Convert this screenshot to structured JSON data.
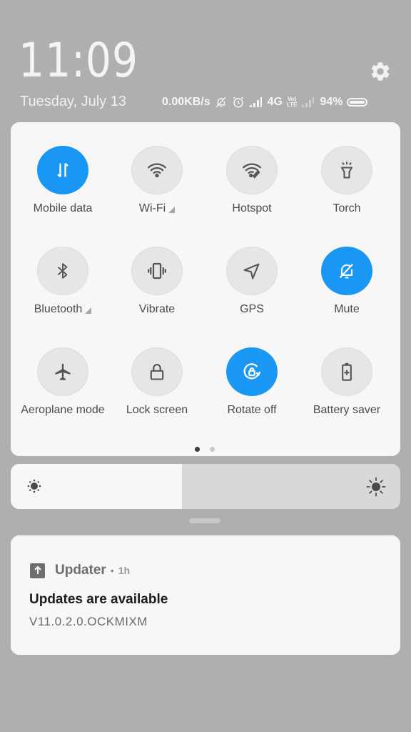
{
  "header": {
    "time": "11:09",
    "date": "Tuesday, July 13",
    "settings_icon": "gear-icon"
  },
  "status_bar": {
    "network_speed": "0.00KB/s",
    "icons": [
      "bell-off-icon",
      "alarm-icon",
      "signal-icon",
      "signal-icon-dim",
      "battery-icon"
    ],
    "network_type": "4G",
    "volte_top": "Vo)",
    "volte_bottom": "LTE",
    "battery_percent": "94%"
  },
  "quick_settings": {
    "tiles": [
      {
        "label": "Mobile data",
        "icon": "mobile-data-icon",
        "active": true,
        "has_expand": false
      },
      {
        "label": "Wi-Fi",
        "icon": "wifi-icon",
        "active": false,
        "has_expand": true
      },
      {
        "label": "Hotspot",
        "icon": "hotspot-icon",
        "active": false,
        "has_expand": false
      },
      {
        "label": "Torch",
        "icon": "torch-icon",
        "active": false,
        "has_expand": false
      },
      {
        "label": "Bluetooth",
        "icon": "bluetooth-icon",
        "active": false,
        "has_expand": true
      },
      {
        "label": "Vibrate",
        "icon": "vibrate-icon",
        "active": false,
        "has_expand": false
      },
      {
        "label": "GPS",
        "icon": "gps-icon",
        "active": false,
        "has_expand": false
      },
      {
        "label": "Mute",
        "icon": "bell-off-icon",
        "active": true,
        "has_expand": false
      },
      {
        "label": "Aeroplane mode",
        "icon": "airplane-icon",
        "active": false,
        "has_expand": false
      },
      {
        "label": "Lock screen",
        "icon": "lock-icon",
        "active": false,
        "has_expand": false
      },
      {
        "label": "Rotate off",
        "icon": "rotate-lock-icon",
        "active": true,
        "has_expand": false
      },
      {
        "label": "Battery saver",
        "icon": "battery-saver-icon",
        "active": false,
        "has_expand": false
      }
    ],
    "page_current": 1,
    "page_count": 2
  },
  "brightness": {
    "level_percent": 44,
    "low_icon": "brightness-low-icon",
    "high_icon": "brightness-high-icon"
  },
  "notification": {
    "app_icon": "upload-arrow-icon",
    "app_name": "Updater",
    "separator": "•",
    "time": "1h",
    "title": "Updates are available",
    "body": "V11.0.2.0.OCKMIXM"
  },
  "colors": {
    "accent": "#1a97f5",
    "background": "#afafaf",
    "panel": "#f7f7f7",
    "tile_inactive": "#e6e6e6"
  }
}
